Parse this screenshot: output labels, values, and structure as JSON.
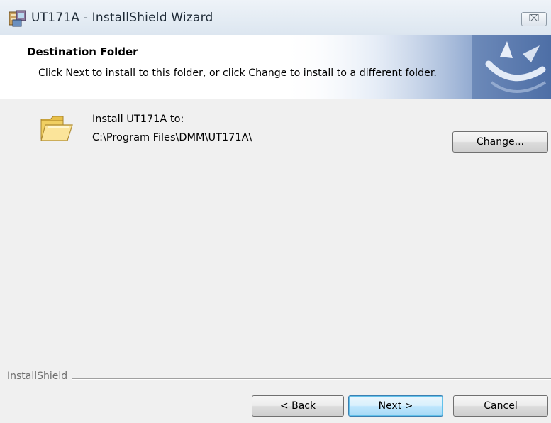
{
  "window": {
    "title": "UT171A - InstallShield Wizard",
    "close_symbol": "⌧"
  },
  "banner": {
    "title": "Destination Folder",
    "description": "Click Next to install to this folder, or click Change to install to a different folder."
  },
  "content": {
    "install_to_label": "Install UT171A to:",
    "install_path": "C:\\Program Files\\DMM\\UT171A\\",
    "change_button": "Change..."
  },
  "footer": {
    "brand": "InstallShield",
    "back_button": "< Back",
    "next_button": "Next >",
    "cancel_button": "Cancel"
  },
  "icons": {
    "app": "installer-icon",
    "folder": "folder-icon",
    "banner": "installshield-logo"
  },
  "colors": {
    "window_bg": "#f0f0f0",
    "banner_bg": "#ffffff",
    "banner_accent": "#4a6fa5",
    "default_button_border": "#3c7fb1"
  }
}
